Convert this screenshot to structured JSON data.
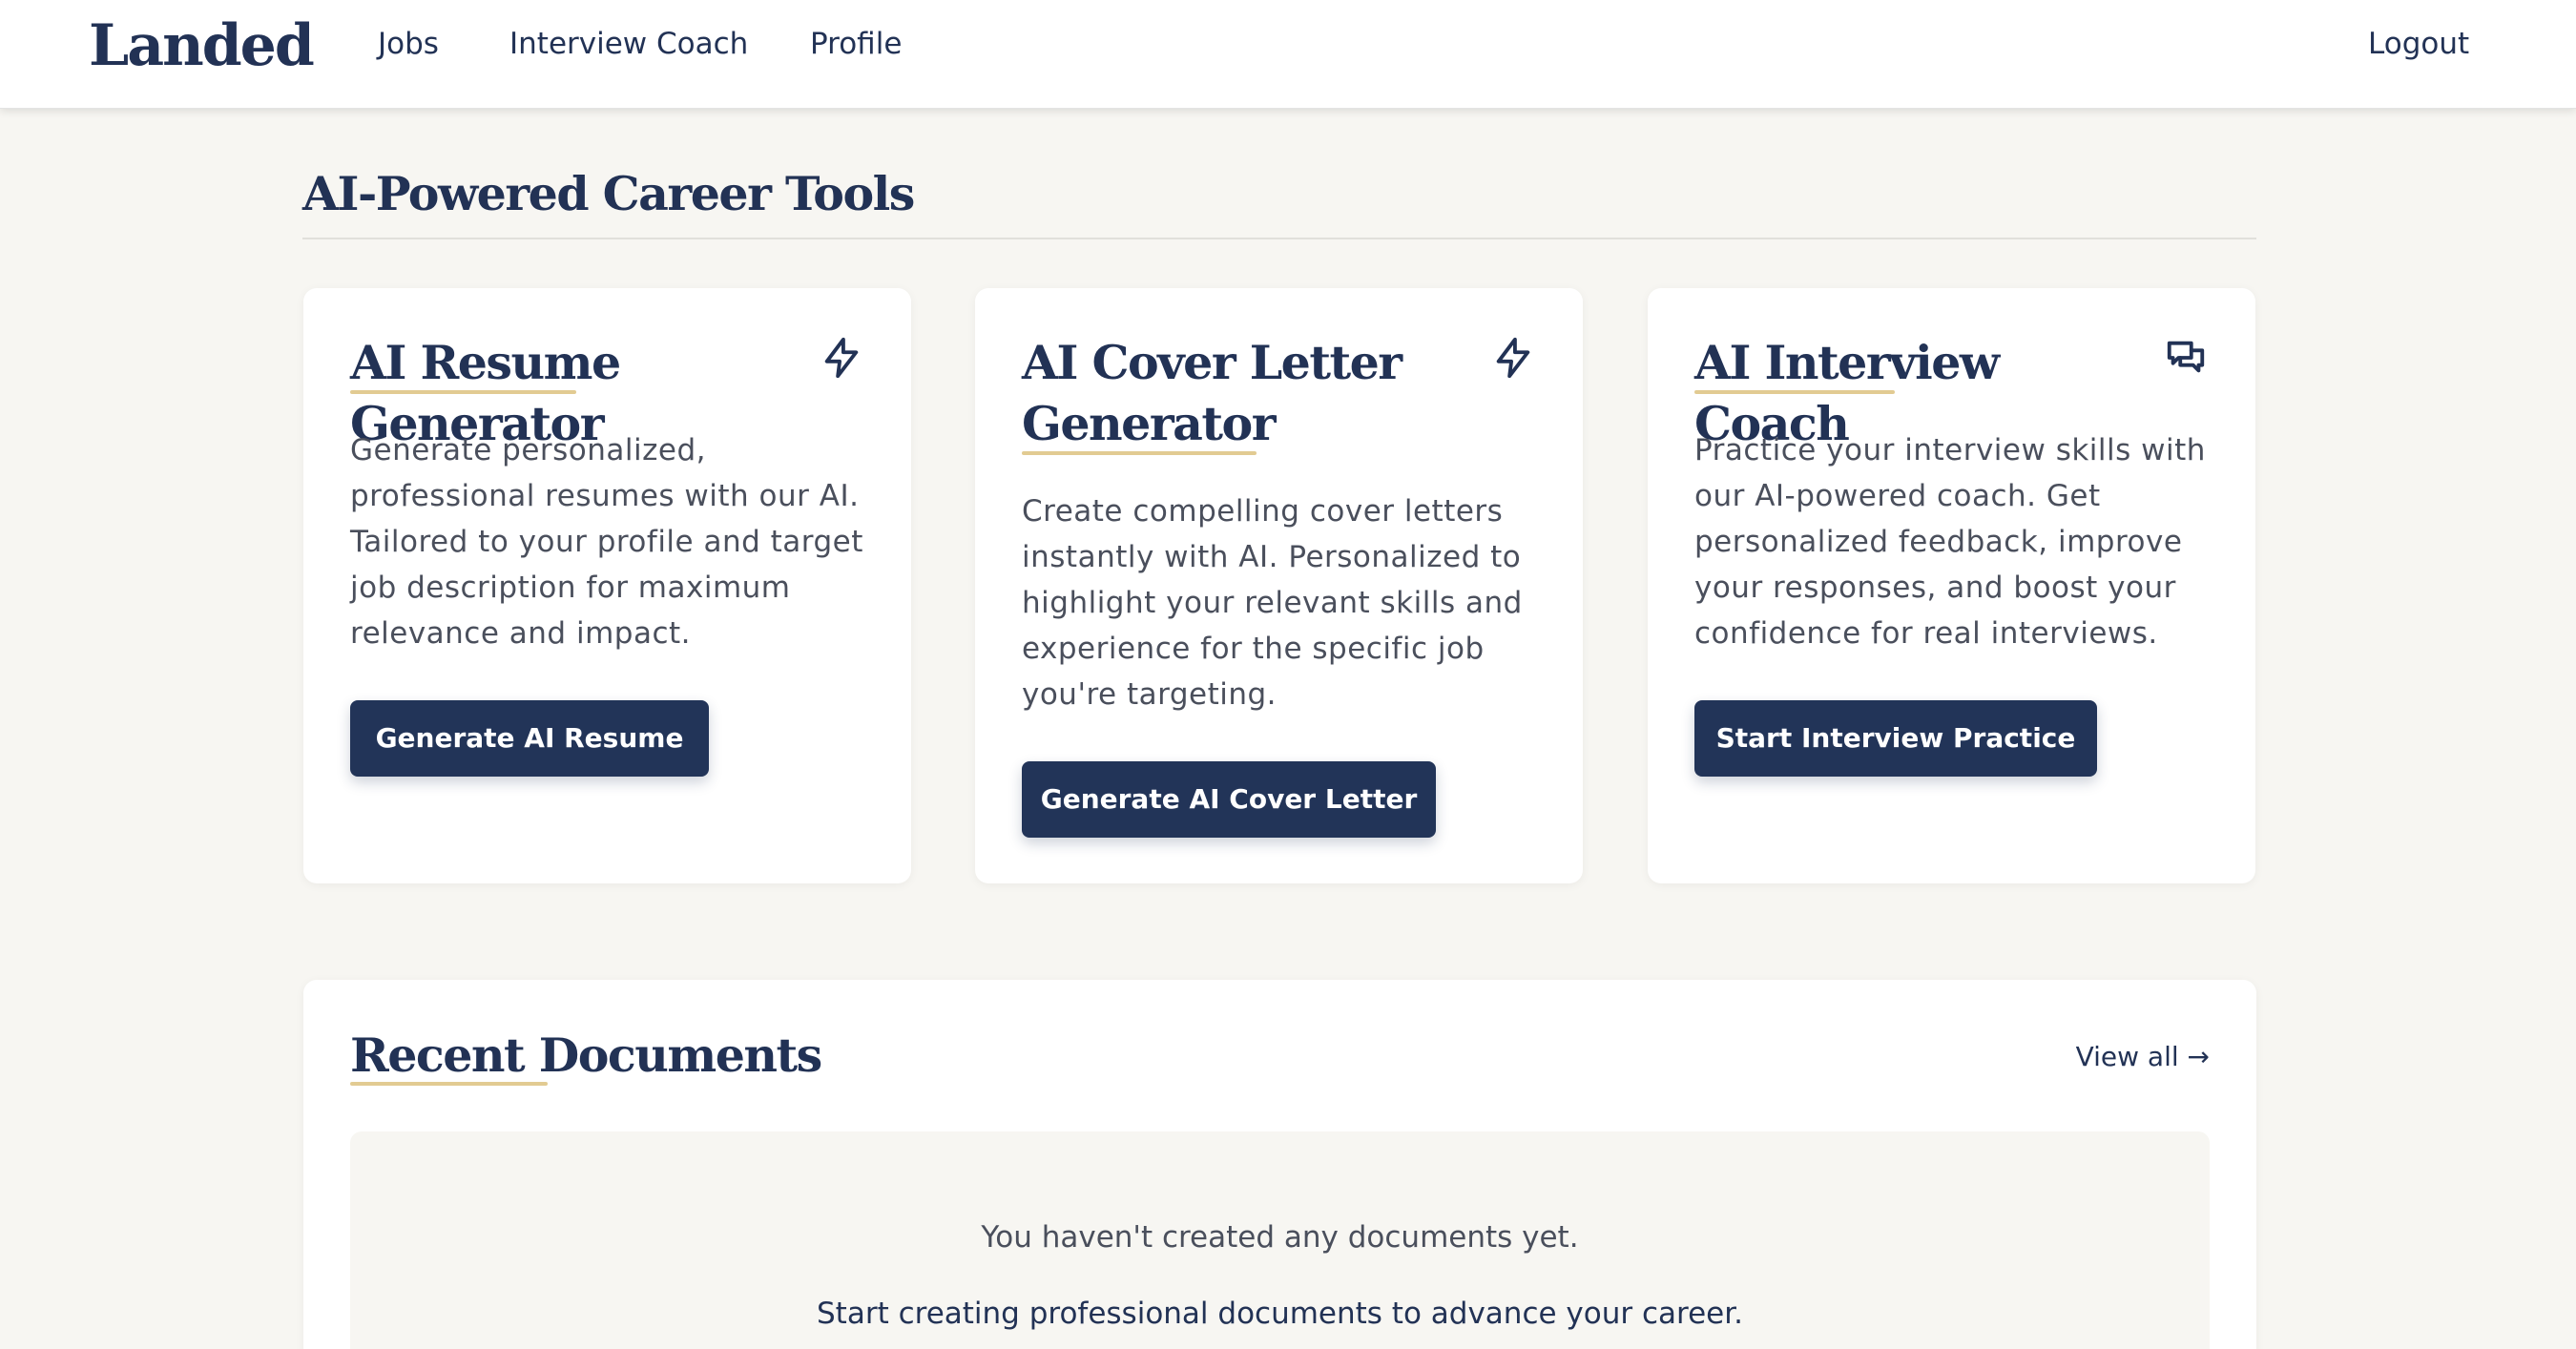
{
  "header": {
    "brand": "Landed",
    "nav": [
      "Jobs",
      "Interview Coach",
      "Profile"
    ],
    "logout": "Logout"
  },
  "tools_section": {
    "title": "AI-Powered Career Tools",
    "cards": [
      {
        "title": "AI Resume Generator",
        "icon": "lightning-icon",
        "description": "Generate personalized, professional resumes with our AI. Tailored to your profile and target job description for maximum relevance and impact.",
        "button": "Generate AI Resume"
      },
      {
        "title": "AI Cover Letter Generator",
        "icon": "lightning-icon",
        "description": "Create compelling cover letters instantly with AI. Personalized to highlight your relevant skills and experience for the specific job you're targeting.",
        "button": "Generate AI Cover Letter"
      },
      {
        "title": "AI Interview Coach",
        "icon": "chat-bubbles-icon",
        "description": "Practice your interview skills with our AI-powered coach. Get personalized feedback, improve your responses, and boost your confidence for real interviews.",
        "button": "Start Interview Practice"
      }
    ]
  },
  "recent_documents": {
    "title": "Recent Documents",
    "view_all": "View all →",
    "empty_message": "You haven't created any documents yet.",
    "empty_cta": "Start creating professional documents to advance your career."
  },
  "colors": {
    "navy": "#223255",
    "button": "#223458",
    "accent_underline": "#e2cb92",
    "background": "#f7f6f2"
  }
}
